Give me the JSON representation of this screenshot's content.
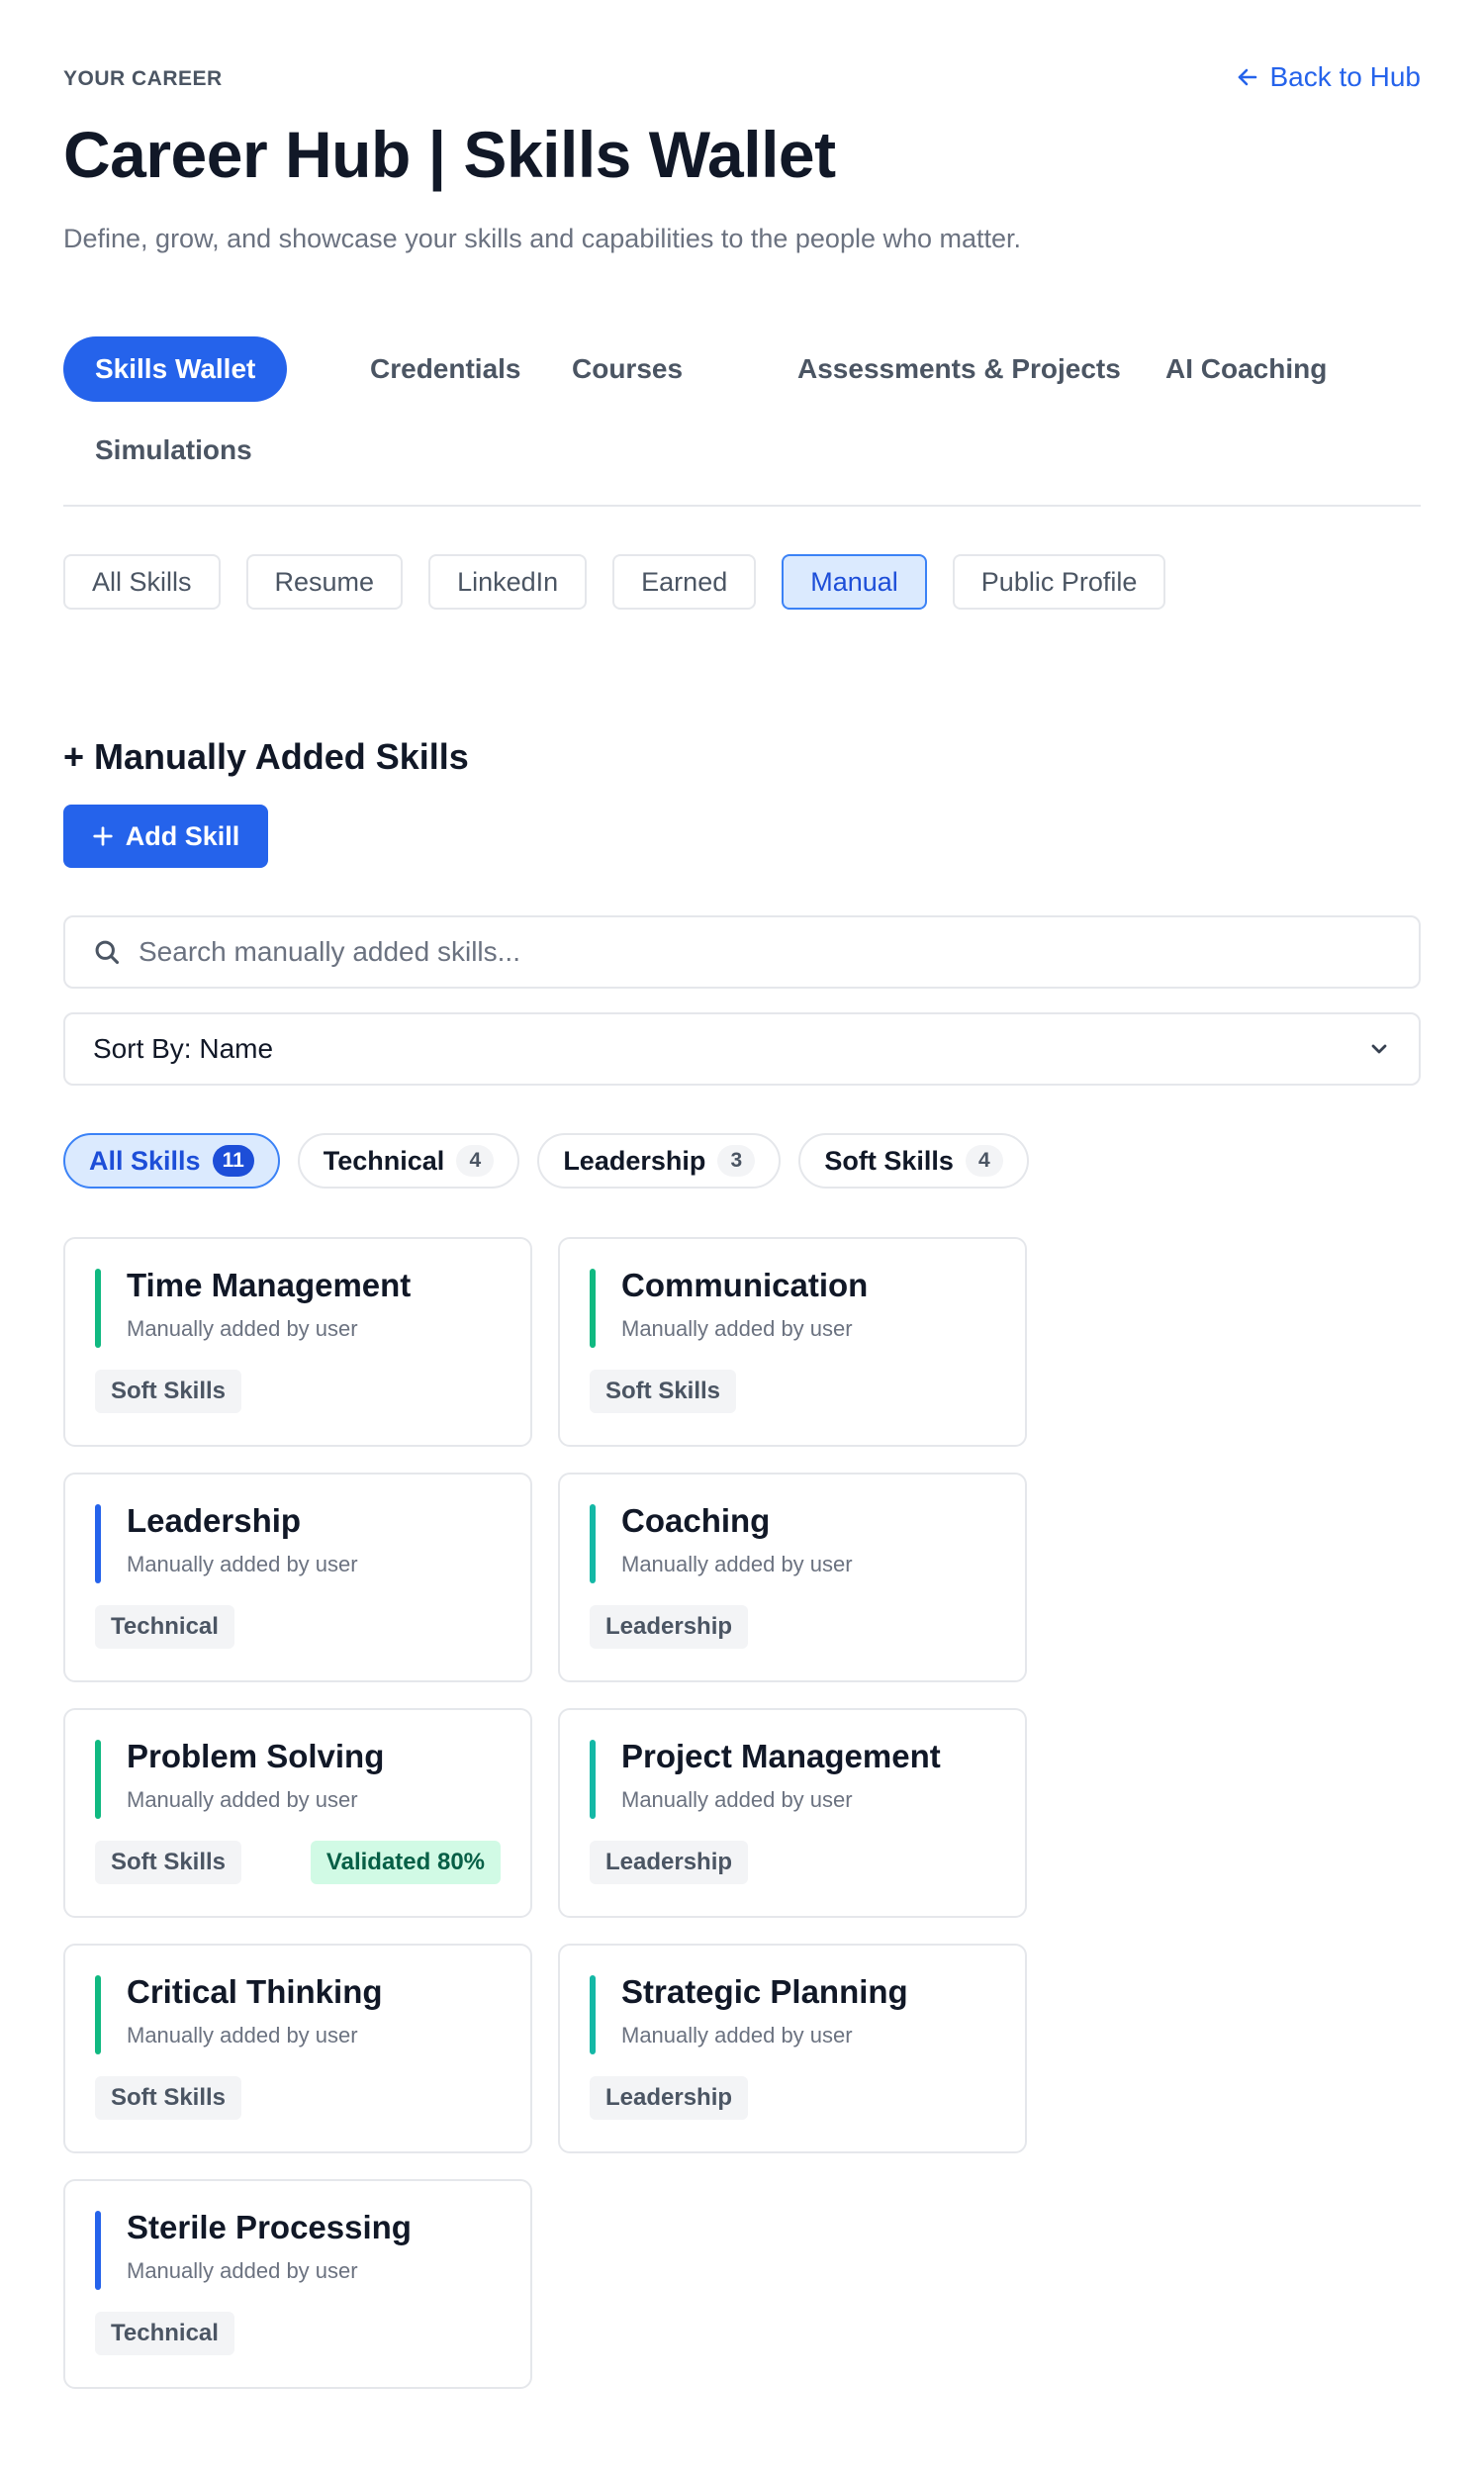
{
  "header": {
    "eyebrow": "YOUR CAREER",
    "title": "Career Hub | Skills Wallet",
    "subtitle": "Define, grow, and showcase your skills and capabilities to the people who matter.",
    "back_label": "Back to Hub"
  },
  "tabs": [
    {
      "label": "Skills Wallet",
      "active": true
    },
    {
      "label": "Credentials"
    },
    {
      "label": "Courses"
    },
    {
      "label": "Assessments & Projects"
    },
    {
      "label": "AI Coaching"
    },
    {
      "label": "Simulations"
    }
  ],
  "filters": [
    {
      "label": "All Skills"
    },
    {
      "label": "Resume"
    },
    {
      "label": "LinkedIn"
    },
    {
      "label": "Earned"
    },
    {
      "label": "Manual",
      "active": true
    },
    {
      "label": "Public Profile"
    }
  ],
  "section": {
    "title": "+ Manually Added Skills",
    "add_label": "Add Skill"
  },
  "search": {
    "placeholder": "Search manually added skills...",
    "value": ""
  },
  "sort": {
    "label": "Sort By: Name"
  },
  "categories": [
    {
      "label": "All Skills",
      "count": "11",
      "active": true
    },
    {
      "label": "Technical",
      "count": "4"
    },
    {
      "label": "Leadership",
      "count": "3"
    },
    {
      "label": "Soft Skills",
      "count": "4"
    }
  ],
  "colors": {
    "accent": "#2563eb",
    "soft_skills": "#10b981",
    "technical": "#2563eb",
    "leadership": "#14b8a6"
  },
  "skills": [
    {
      "name": "Time Management",
      "source": "Manually added by user",
      "tag": "Soft Skills",
      "color": "#10b981"
    },
    {
      "name": "Communication",
      "source": "Manually added by user",
      "tag": "Soft Skills",
      "color": "#10b981"
    },
    {
      "name": "Leadership",
      "source": "Manually added by user",
      "tag": "Technical",
      "color": "#2563eb"
    },
    {
      "name": "Coaching",
      "source": "Manually added by user",
      "tag": "Leadership",
      "color": "#14b8a6"
    },
    {
      "name": "Problem Solving",
      "source": "Manually added by user",
      "tag": "Soft Skills",
      "color": "#10b981",
      "validated": "Validated 80%"
    },
    {
      "name": "Project Management",
      "source": "Manually added by user",
      "tag": "Leadership",
      "color": "#14b8a6"
    },
    {
      "name": "Critical Thinking",
      "source": "Manually added by user",
      "tag": "Soft Skills",
      "color": "#10b981"
    },
    {
      "name": "Strategic Planning",
      "source": "Manually added by user",
      "tag": "Leadership",
      "color": "#14b8a6"
    },
    {
      "name": "Sterile Processing",
      "source": "Manually added by user",
      "tag": "Technical",
      "color": "#2563eb"
    }
  ]
}
